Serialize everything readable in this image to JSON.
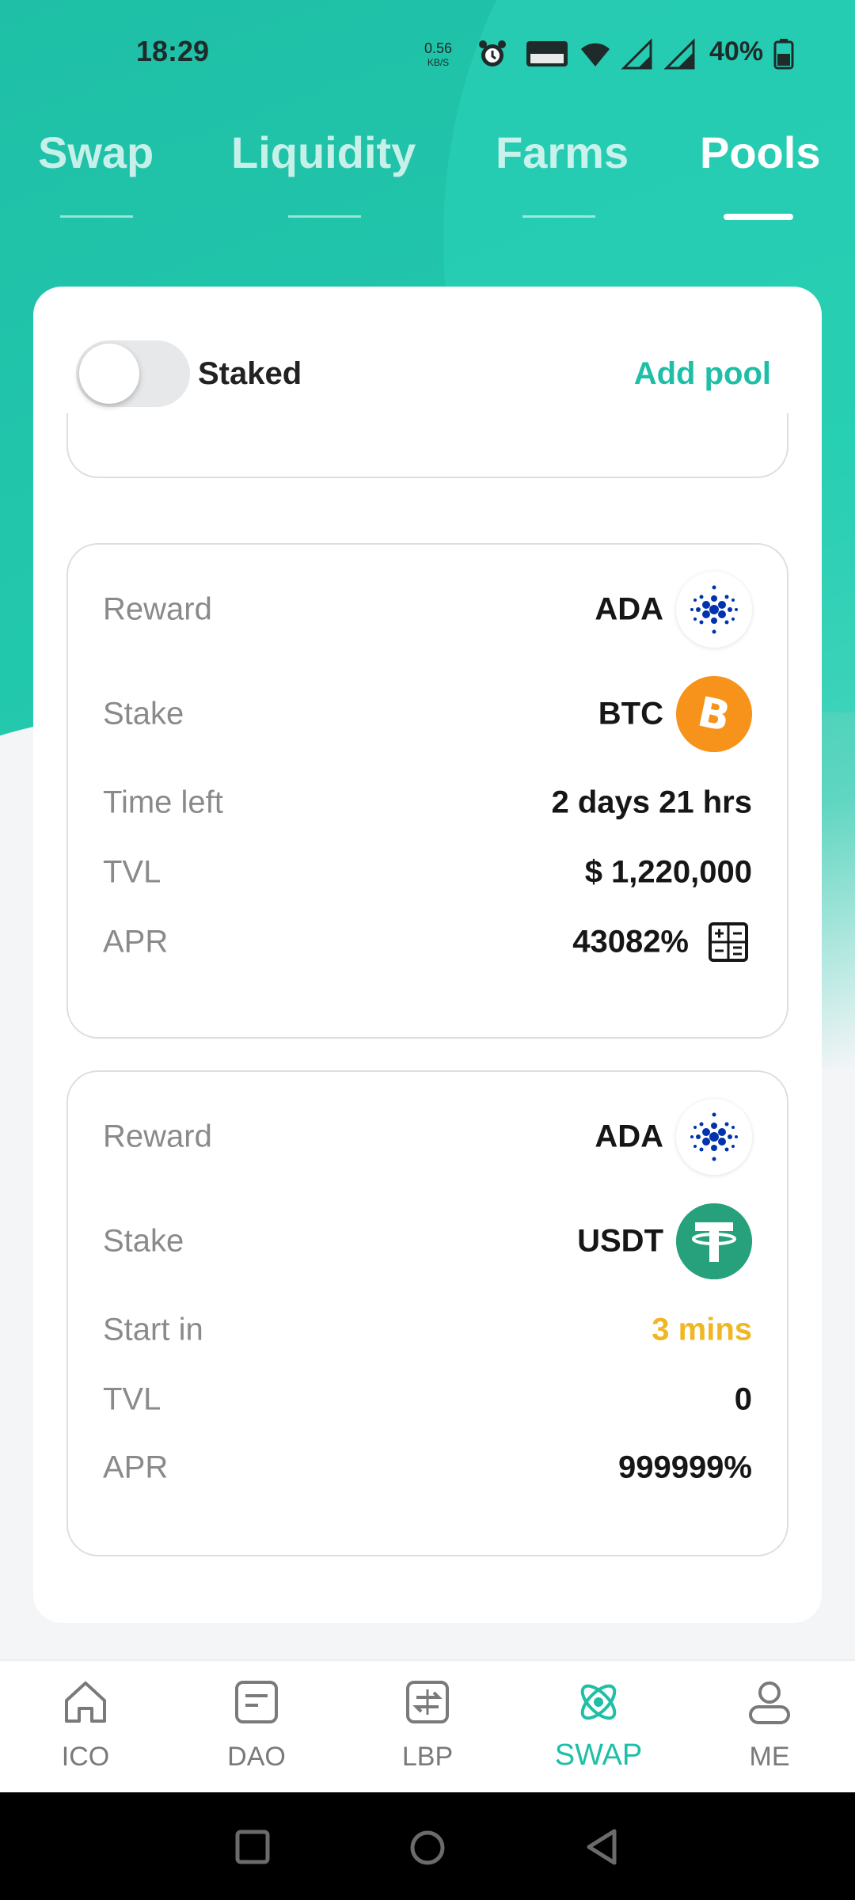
{
  "status_bar": {
    "time": "18:29",
    "net_speed": "0.56",
    "net_speed_unit": "KB/S",
    "battery": "40%"
  },
  "tabs": [
    {
      "label": "Swap",
      "active": false
    },
    {
      "label": "Liquidity",
      "active": false
    },
    {
      "label": "Farms",
      "active": false
    },
    {
      "label": "Pools",
      "active": true
    }
  ],
  "panel": {
    "staked_label": "Staked",
    "staked_on": false,
    "add_pool_label": "Add pool"
  },
  "pools": [
    {
      "rows": [
        {
          "label": "Reward",
          "value": "ADA",
          "icon": "ada-coin-icon"
        },
        {
          "label": "Stake",
          "value": "BTC",
          "icon": "btc-coin-icon"
        },
        {
          "label": "Time left",
          "value": "2 days 21 hrs"
        },
        {
          "label": "TVL",
          "value": "$ 1,220,000"
        },
        {
          "label": "APR",
          "value": "43082%",
          "icon": "calculator-icon"
        }
      ]
    },
    {
      "rows": [
        {
          "label": "Reward",
          "value": "ADA",
          "icon": "ada-coin-icon"
        },
        {
          "label": "Stake",
          "value": "USDT",
          "icon": "usdt-coin-icon"
        },
        {
          "label": "Start in",
          "value": "3 mins",
          "color": "#f0b722"
        },
        {
          "label": "TVL",
          "value": "0"
        },
        {
          "label": "APR",
          "value": "999999%"
        }
      ]
    }
  ],
  "bottom_nav": [
    {
      "label": "ICO",
      "icon": "home-icon",
      "active": false
    },
    {
      "label": "DAO",
      "icon": "document-icon",
      "active": false
    },
    {
      "label": "LBP",
      "icon": "exchange-icon",
      "active": false
    },
    {
      "label": "SWAP",
      "icon": "swap-atom-icon",
      "active": true
    },
    {
      "label": "ME",
      "icon": "user-icon",
      "active": false
    }
  ],
  "colors": {
    "accent": "#1ebfa6",
    "warning": "#f0b722",
    "btc": "#f7931a",
    "usdt": "#26a17b",
    "ada": "#0033ad"
  }
}
